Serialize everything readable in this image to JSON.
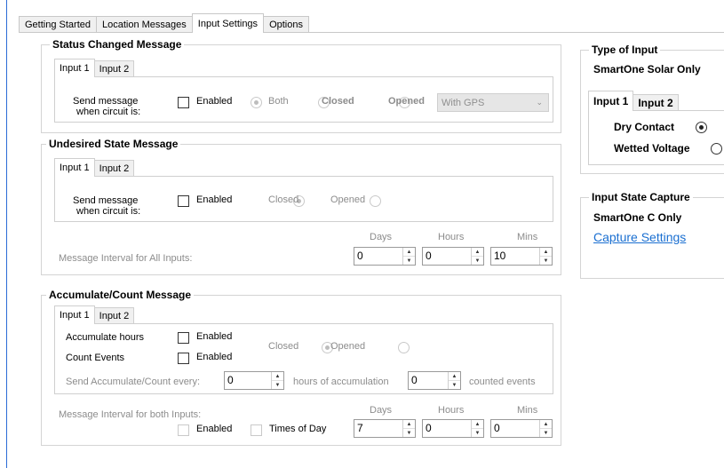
{
  "main_tabs": [
    "Getting Started",
    "Location Messages",
    "Input Settings",
    "Options"
  ],
  "status_changed": {
    "title": "Status Changed Message",
    "tabs": [
      "Input 1",
      "Input 2"
    ],
    "label_line1": "Send message",
    "label_line2": "when circuit is:",
    "enabled_label": "Enabled",
    "both": "Both",
    "closed": "Closed",
    "opened": "Opened",
    "gps_select": "With GPS"
  },
  "undesired": {
    "title": "Undesired State Message",
    "tabs": [
      "Input 1",
      "Input 2"
    ],
    "label_line1": "Send message",
    "label_line2": "when circuit is:",
    "enabled_label": "Enabled",
    "closed": "Closed",
    "opened": "Opened",
    "interval_label": "Message Interval for All Inputs:",
    "days_label": "Days",
    "hours_label": "Hours",
    "mins_label": "Mins",
    "days": "0",
    "hours": "0",
    "mins": "10"
  },
  "accumulate": {
    "title": "Accumulate/Count Message",
    "tabs": [
      "Input 1",
      "Input 2"
    ],
    "accumulate_hours": "Accumulate hours",
    "count_events": "Count Events",
    "enabled_label": "Enabled",
    "closed": "Closed",
    "opened": "Opened",
    "send_every": "Send Accumulate/Count every:",
    "every_value": "0",
    "hours_of_accumulation": "hours of accumulation",
    "counted_value": "0",
    "counted_events": "counted events",
    "interval_label": "Message Interval for both Inputs:",
    "times_of_day": "Times of Day",
    "days_label": "Days",
    "hours_label": "Hours",
    "mins_label": "Mins",
    "days": "7",
    "hours": "0",
    "mins": "0"
  },
  "type_of_input": {
    "title": "Type of Input",
    "subtitle": "SmartOne Solar Only",
    "tabs": [
      "Input 1",
      "Input 2"
    ],
    "dry_contact": "Dry Contact",
    "wetted_voltage": "Wetted Voltage"
  },
  "state_capture": {
    "title": "Input State Capture",
    "subtitle": "SmartOne C Only",
    "link": "Capture Settings"
  }
}
